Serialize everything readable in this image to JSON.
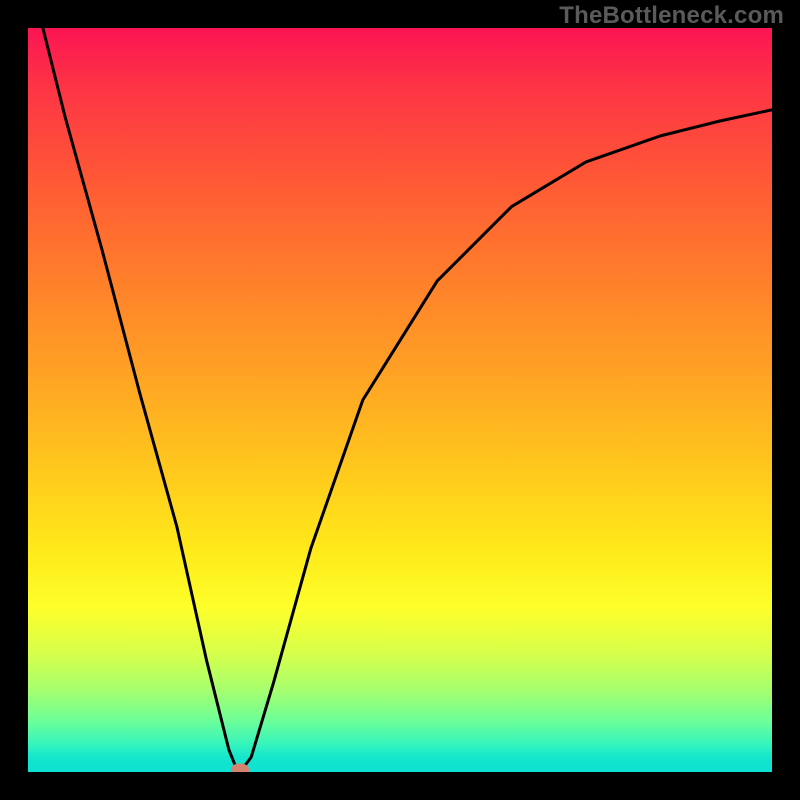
{
  "watermark": "TheBottleneck.com",
  "chart_data": {
    "type": "line",
    "title": "",
    "xlabel": "",
    "ylabel": "",
    "xlim": [
      0,
      1
    ],
    "ylim": [
      0,
      1
    ],
    "series": [
      {
        "name": "curve",
        "x": [
          0.02,
          0.05,
          0.1,
          0.15,
          0.2,
          0.24,
          0.27,
          0.28,
          0.285,
          0.3,
          0.33,
          0.38,
          0.45,
          0.55,
          0.65,
          0.75,
          0.85,
          0.93,
          1.0
        ],
        "values": [
          1.0,
          0.88,
          0.7,
          0.51,
          0.33,
          0.15,
          0.03,
          0.005,
          0.0,
          0.02,
          0.12,
          0.3,
          0.5,
          0.66,
          0.76,
          0.82,
          0.855,
          0.875,
          0.89
        ]
      }
    ],
    "marker": {
      "x": 0.285,
      "y": 0.0
    },
    "gradient_colors": {
      "top": "#fb1553",
      "mid": "#ffe91a",
      "bottom": "#0ee0d3"
    }
  }
}
